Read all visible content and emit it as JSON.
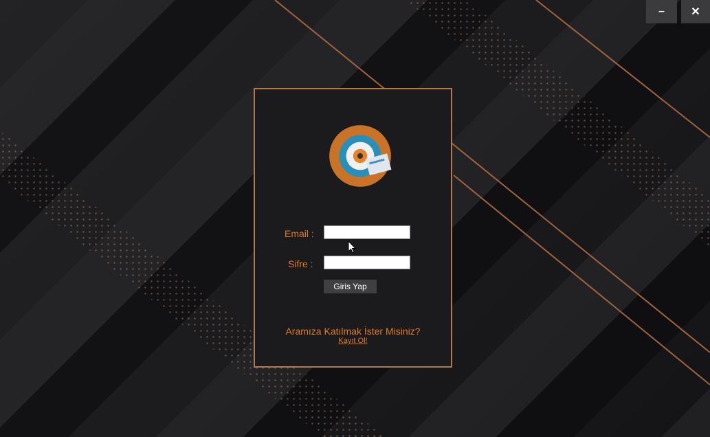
{
  "window": {
    "minimize_label": "–",
    "close_label": "✕"
  },
  "login": {
    "email_label": "Email :",
    "email_value": "",
    "password_label": "Sifre :",
    "password_value": "",
    "submit_label": "Giris Yap",
    "signup_prompt": "Aramıza Katılmak İster Misiniz?",
    "signup_link": "Kayıt Ol!"
  },
  "colors": {
    "accent": "#e07b22",
    "border": "#b07a4e",
    "button": "#3f3f41"
  }
}
